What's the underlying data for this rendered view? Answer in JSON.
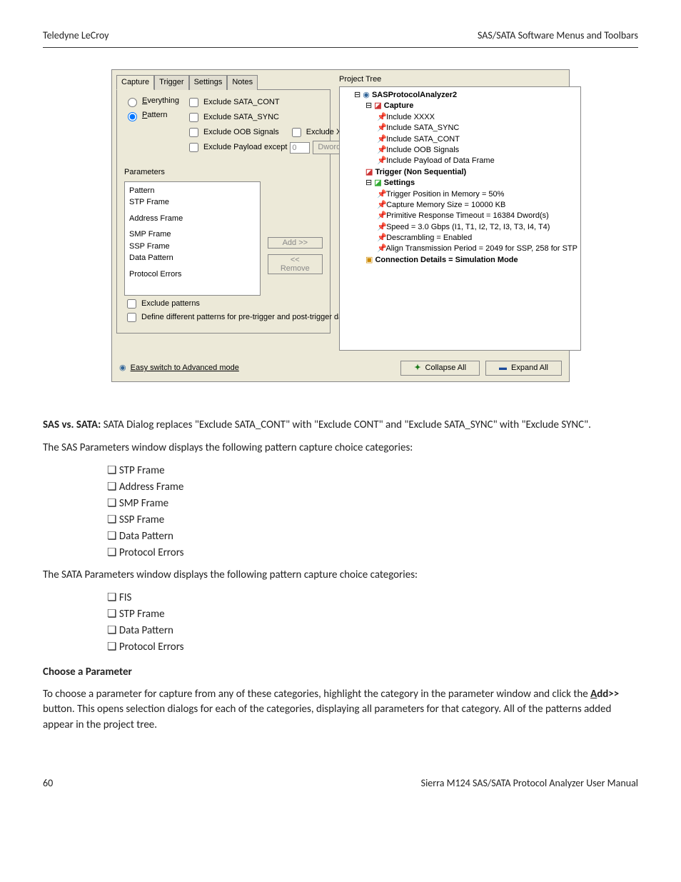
{
  "header": {
    "left": "Teledyne LeCroy",
    "right": "SAS/SATA Software Menus and Toolbars"
  },
  "screenshot": {
    "tabs": {
      "capture": "Capture",
      "trigger": "Trigger",
      "settings": "Settings",
      "notes": "Notes"
    },
    "radios": {
      "everything": "Everything",
      "pattern": "Pattern"
    },
    "exclude": {
      "cont": "Exclude SATA_CONT",
      "sync": "Exclude SATA_SYNC",
      "oob": "Exclude OOB Signals",
      "xxxx": "Exclude XXXX",
      "payload": "Exclude Payload except",
      "payload_value": "0",
      "dword": "Dword(s)"
    },
    "parameters_label": "Parameters",
    "param_list": {
      "pattern": "Pattern",
      "stp": "STP Frame",
      "address": "Address Frame",
      "smp": "SMP Frame",
      "ssp": "SSP Frame",
      "data": "Data Pattern",
      "proto": "Protocol Errors"
    },
    "add_btn": "Add >>",
    "remove_btn": "<< Remove",
    "exclude_patterns": "Exclude patterns",
    "define_diff": "Define different patterns for pre-trigger and post-trigger data captures",
    "project_tree_label": "Project Tree",
    "tree": {
      "root": "SASProtocolAnalyzer2",
      "capture": "Capture",
      "inc_xxxx": "Include XXXX",
      "inc_sync": "Include SATA_SYNC",
      "inc_cont": "Include SATA_CONT",
      "inc_oob": "Include OOB Signals",
      "inc_payload": "Include Payload of Data Frame",
      "trigger": "Trigger (Non Sequential)",
      "settings": "Settings",
      "trig_pos": "Trigger Position in Memory = 50%",
      "mem_size": "Capture Memory Size = 10000 KB",
      "prim_resp": "Primitive Response Timeout = 16384 Dword(s)",
      "speed": "Speed = 3.0 Gbps (I1, T1, I2, T2, I3, T3, I4, T4)",
      "descramble": "Descrambling = Enabled",
      "align": "Align Transmission Period = 2049 for SSP, 258 for STP",
      "conn": "Connection Details = Simulation Mode"
    },
    "easy_switch": "Easy switch to Advanced mode",
    "collapse": "Collapse All",
    "expand": "Expand All"
  },
  "body": {
    "sas_sata_lead": "SAS vs. SATA:",
    "sas_sata_rest": " SATA Dialog replaces \"Exclude SATA_CONT\" with \"Exclude CONT\" and \"Exclude SATA_SYNC\" with \"Exclude SYNC\".",
    "sas_params_intro": "The SAS Parameters window displays the following pattern capture choice categories:",
    "sas_list": {
      "b1": "STP Frame",
      "b2": "Address Frame",
      "b3": "SMP Frame",
      "b4": "SSP Frame",
      "b5": "Data Pattern",
      "b6": "Protocol Errors"
    },
    "sata_params_intro": "The SATA Parameters window displays the following pattern capture choice categories:",
    "sata_list": {
      "b1": "FIS",
      "b2": "STP Frame",
      "b3": "Data Pattern",
      "b4": "Protocol Errors"
    },
    "choose_head": "Choose a Parameter",
    "choose_p1a": "To choose a parameter for capture from any of these categories, highlight the category in the parameter window and click the ",
    "choose_add": "Add>>",
    "choose_p1b": " button. This opens selection dialogs for each of the categories, displaying all parameters for that category. All of the patterns added appear in the project tree."
  },
  "footer": {
    "page": "60",
    "manual": "Sierra M124 SAS/SATA Protocol Analyzer User Manual"
  }
}
